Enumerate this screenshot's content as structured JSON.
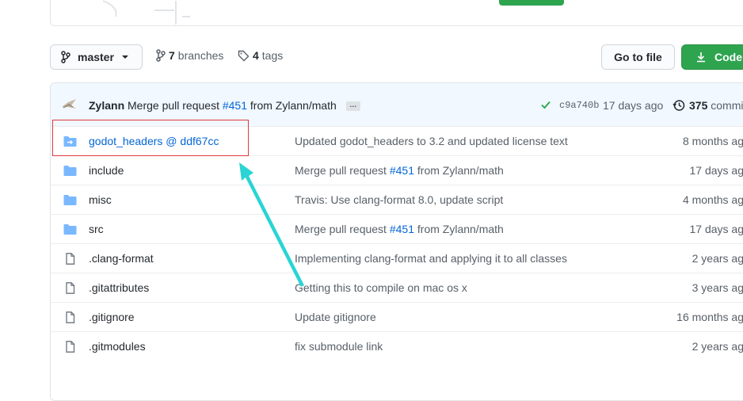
{
  "top": {},
  "toolbar": {
    "branch_label": "master",
    "branches_count": "7",
    "branches_label": "branches",
    "tags_count": "4",
    "tags_label": "tags",
    "goto_file_label": "Go to file",
    "code_label": "Code"
  },
  "commit": {
    "author": "Zylann",
    "message_prefix": "Merge pull request",
    "pr": "#451",
    "message_suffix": "from Zylann/math",
    "ellipsis": "…",
    "sha": "c9a740b",
    "age": "17 days ago",
    "commits_count": "375",
    "commits_label": "commi"
  },
  "files": [
    {
      "icon": "submodule-icon",
      "name": "godot_headers @ ddf67cc",
      "msg_prefix": "Updated godot_headers to 3.2 and updated license text",
      "msg_pr": "",
      "msg_suffix": "",
      "time": "8 months ag"
    },
    {
      "icon": "folder-icon",
      "name": "include",
      "msg_prefix": "Merge pull request",
      "msg_pr": "#451",
      "msg_suffix": "from Zylann/math",
      "time": "17 days ag"
    },
    {
      "icon": "folder-icon",
      "name": "misc",
      "msg_prefix": "Travis: Use clang-format 8.0, update script",
      "msg_pr": "",
      "msg_suffix": "",
      "time": "4 months ag"
    },
    {
      "icon": "folder-icon",
      "name": "src",
      "msg_prefix": "Merge pull request",
      "msg_pr": "#451",
      "msg_suffix": "from Zylann/math",
      "time": "17 days ag"
    },
    {
      "icon": "file-icon",
      "name": ".clang-format",
      "msg_prefix": "Implementing clang-format and applying it to all classes",
      "msg_pr": "",
      "msg_suffix": "",
      "time": "2 years ag"
    },
    {
      "icon": "file-icon",
      "name": ".gitattributes",
      "msg_prefix": "Getting this to compile on mac os x",
      "msg_pr": "",
      "msg_suffix": "",
      "time": "3 years ag"
    },
    {
      "icon": "file-icon",
      "name": ".gitignore",
      "msg_prefix": "Update gitignore",
      "msg_pr": "",
      "msg_suffix": "",
      "time": "16 months ag"
    },
    {
      "icon": "file-icon",
      "name": ".gitmodules",
      "msg_prefix": "fix submodule link",
      "msg_pr": "",
      "msg_suffix": "",
      "time": "2 years ag"
    }
  ],
  "colors": {
    "accent_link": "#0366d6",
    "primary_button": "#2ea44f",
    "folder": "#79b8ff",
    "annotation_box": "#e0393e",
    "annotation_arrow": "#2ad4d4"
  }
}
